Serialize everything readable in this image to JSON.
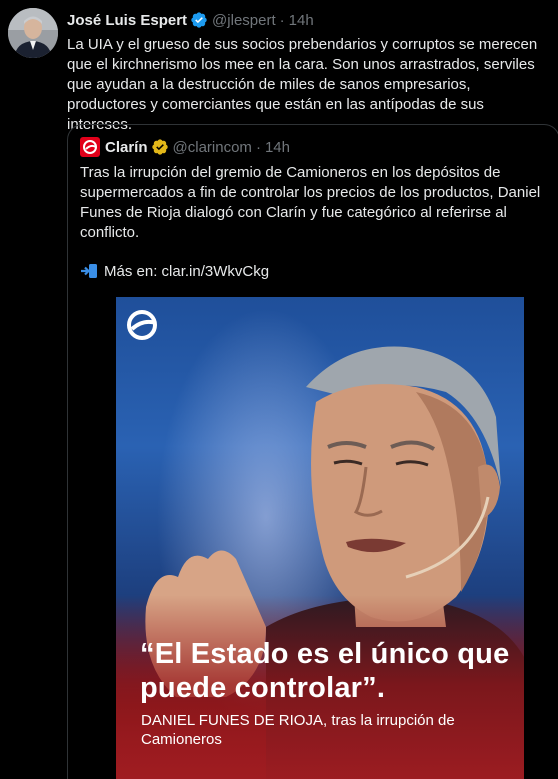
{
  "tweet": {
    "author_name": "José Luis Espert",
    "handle": "@jlespert",
    "separator": "·",
    "time": "14h",
    "text": "La UIA y el grueso de sus socios prebendarios y corruptos se merecen que el kirchnerismo los mee en la cara. Son unos arrastrados, serviles que ayudan a la destrucción de miles de sanos empresarios, productores y comerciantes que están en las antípodas de sus intereses."
  },
  "quoted": {
    "author_name": "Clarín",
    "handle": "@clarincom",
    "separator": "·",
    "time": "14h",
    "text": "Tras la irrupción del gremio de Camioneros en los depósitos de supermercados a fin de controlar los precios de los productos, Daniel Funes de Rioja dialogó con Clarín y fue categórico al referirse al conflicto.",
    "link_text": "Más en: clar.in/3WkvCkg",
    "media": {
      "quote": "“El Estado es el único que puede controlar”.",
      "caption": "DANIEL FUNES DE RIOJA, tras la irrupción de Camioneros"
    }
  },
  "icons": {
    "verified": "verified-badge-icon",
    "gold_verified": "gold-verified-badge-icon",
    "link": "arrow-right-icon",
    "brand": "clarin-logo-icon"
  },
  "colors": {
    "background": "#000000",
    "text": "#e7e9ea",
    "muted": "#71767b",
    "border": "#2f3336",
    "verified_blue": "#1d9bf0",
    "gold": "#e2b719",
    "clarin_red": "#e2001a"
  }
}
